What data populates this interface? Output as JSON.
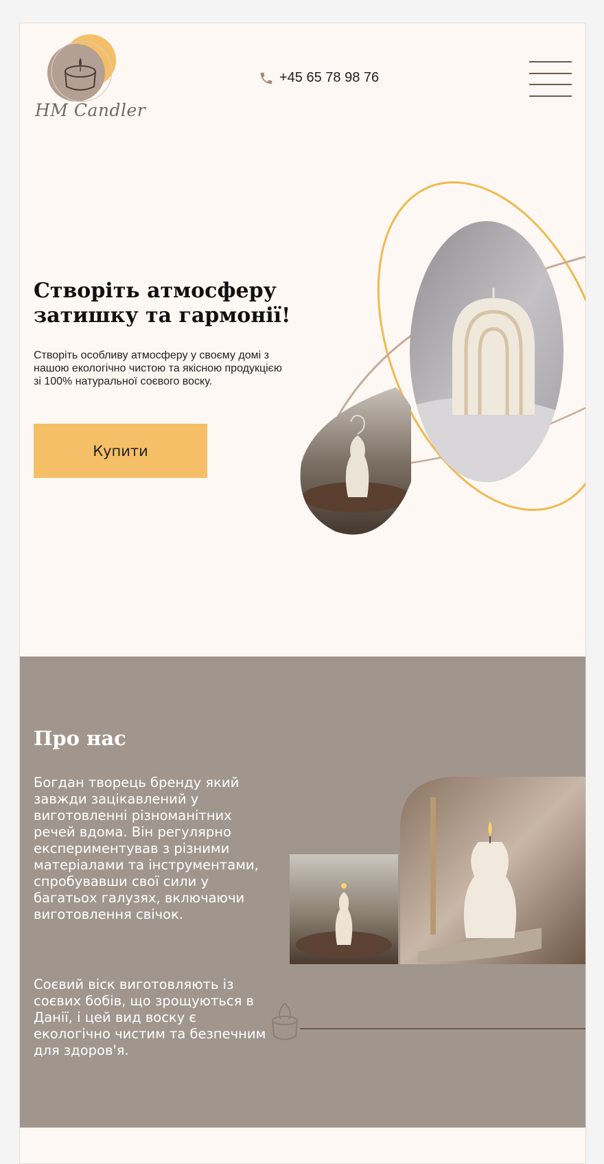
{
  "header": {
    "logo_text": "HM Candler",
    "phone": "+45 65 78 98 76"
  },
  "hero": {
    "title": "Створіть атмосферу затишку та гармонії!",
    "description": "Створіть особливу атмосферу у своєму домі з нашою екологічно чистою та якісною продукцією зі 100% натуральної соєвого воску.",
    "buy_label": "Купити"
  },
  "about": {
    "title": "Про нас",
    "paragraph1": "Богдан творець бренду який завжди зацікавлений у виготовленні різноманітних речей вдома. Він регулярно експериментував з різними матеріалами та інструментами, спробувавши свої сили у багатьох галузях, включаючи виготовлення свічок.",
    "paragraph2": "Соєвий віск виготовляють із соєвих бобів, що зрощуються в Данії, і цей вид воску є екологічно чистим та безпечним для здоров'я."
  },
  "colors": {
    "accent_yellow": "#f5bf68",
    "taupe": "#a1968e",
    "cream": "#fdf8f4",
    "brown_line": "#6d5a4a"
  },
  "icons": [
    "candle-logo-icon",
    "phone-icon",
    "menu-icon",
    "candle-outline-icon"
  ]
}
